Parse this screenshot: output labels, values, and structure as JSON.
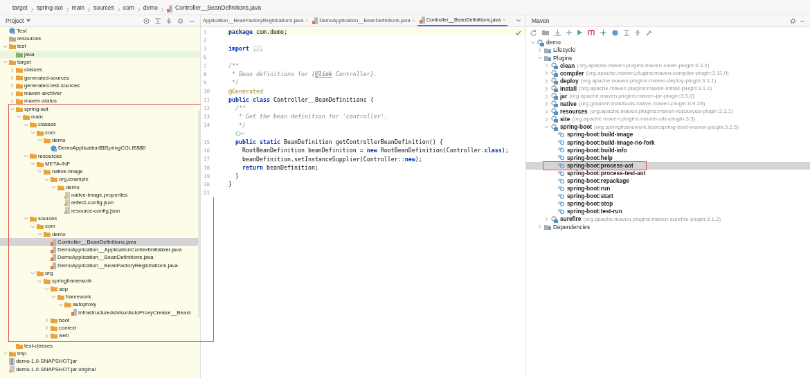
{
  "breadcrumb": [
    "target",
    "spring-aot",
    "main",
    "sources",
    "com",
    "demo",
    "Controller__BeanDefinitions.java"
  ],
  "project": {
    "title": "Project",
    "tree": [
      {
        "label": "Test",
        "kind": "class",
        "selected": false,
        "highlighted": false,
        "boxed": false
      },
      {
        "label": "resources",
        "kind": "resources",
        "selected": false,
        "highlighted": false,
        "boxed": false
      },
      {
        "label": "test",
        "kind": "folder",
        "expanded": true,
        "selected": false,
        "highlighted": false,
        "boxed": false,
        "children": [
          {
            "label": "java",
            "kind": "source",
            "selected": false,
            "highlighted": true,
            "boxed": false
          }
        ]
      },
      {
        "label": "target",
        "kind": "folder",
        "expanded": true,
        "selected": false,
        "highlighted": false,
        "boxed": false,
        "children": [
          {
            "label": "classes",
            "kind": "folder",
            "expanded": false,
            "selected": false,
            "highlighted": false,
            "boxed": false
          },
          {
            "label": "generated-sources",
            "kind": "folder",
            "expanded": false,
            "selected": false,
            "highlighted": false,
            "boxed": false
          },
          {
            "label": "generated-test-sources",
            "kind": "folder",
            "expanded": false,
            "selected": false,
            "highlighted": false,
            "boxed": false
          },
          {
            "label": "maven-archiver",
            "kind": "folder",
            "expanded": false,
            "selected": false,
            "highlighted": false,
            "boxed": false
          },
          {
            "label": "maven-status",
            "kind": "folder",
            "expanded": false,
            "selected": false,
            "highlighted": false,
            "boxed": false
          },
          {
            "label": "spring-aot",
            "kind": "folder",
            "expanded": true,
            "selected": false,
            "highlighted": false,
            "boxed": true,
            "children": [
              {
                "label": "main",
                "kind": "folder",
                "expanded": true,
                "selected": false,
                "highlighted": false,
                "boxed": false,
                "children": [
                  {
                    "label": "classes",
                    "kind": "folder",
                    "expanded": true,
                    "selected": false,
                    "highlighted": false,
                    "boxed": false,
                    "children": [
                      {
                        "label": "com",
                        "kind": "folder",
                        "expanded": true,
                        "selected": false,
                        "highlighted": false,
                        "boxed": false,
                        "children": [
                          {
                            "label": "demo",
                            "kind": "folder",
                            "expanded": true,
                            "selected": false,
                            "highlighted": false,
                            "boxed": false,
                            "children": [
                              {
                                "label": "DemoApplication$$SpringCGLIB$$0",
                                "kind": "class",
                                "selected": false,
                                "highlighted": false,
                                "boxed": false
                              }
                            ]
                          }
                        ]
                      }
                    ]
                  },
                  {
                    "label": "resources",
                    "kind": "folder",
                    "expanded": true,
                    "selected": false,
                    "highlighted": false,
                    "boxed": false,
                    "children": [
                      {
                        "label": "META-INF",
                        "kind": "folder",
                        "expanded": true,
                        "selected": false,
                        "highlighted": false,
                        "boxed": false,
                        "children": [
                          {
                            "label": "native-image",
                            "kind": "folder",
                            "expanded": true,
                            "selected": false,
                            "highlighted": false,
                            "boxed": false,
                            "children": [
                              {
                                "label": "org.example",
                                "kind": "folder",
                                "expanded": true,
                                "selected": false,
                                "highlighted": false,
                                "boxed": false,
                                "children": [
                                  {
                                    "label": "demo",
                                    "kind": "folder",
                                    "expanded": true,
                                    "selected": false,
                                    "highlighted": false,
                                    "boxed": false,
                                    "children": [
                                      {
                                        "label": "native-image.properties",
                                        "kind": "config",
                                        "selected": false,
                                        "highlighted": false,
                                        "boxed": false
                                      },
                                      {
                                        "label": "reflect-config.json",
                                        "kind": "config",
                                        "selected": false,
                                        "highlighted": false,
                                        "boxed": false
                                      },
                                      {
                                        "label": "resource-config.json",
                                        "kind": "config",
                                        "selected": false,
                                        "highlighted": false,
                                        "boxed": false
                                      }
                                    ]
                                  }
                                ]
                              }
                            ]
                          }
                        ]
                      }
                    ]
                  },
                  {
                    "label": "sources",
                    "kind": "folder",
                    "expanded": true,
                    "selected": false,
                    "highlighted": false,
                    "boxed": false,
                    "children": [
                      {
                        "label": "com",
                        "kind": "folder",
                        "expanded": true,
                        "selected": false,
                        "highlighted": false,
                        "boxed": false,
                        "children": [
                          {
                            "label": "demo",
                            "kind": "folder",
                            "expanded": true,
                            "selected": false,
                            "highlighted": false,
                            "boxed": false,
                            "children": [
                              {
                                "label": "Controller__BeanDefinitions.java",
                                "kind": "java",
                                "selected": true,
                                "highlighted": false,
                                "boxed": false
                              },
                              {
                                "label": "DemoApplication__ApplicationContextInitializer.java",
                                "kind": "java",
                                "selected": false,
                                "highlighted": false,
                                "boxed": false
                              },
                              {
                                "label": "DemoApplication__BeanDefinitions.java",
                                "kind": "java",
                                "selected": false,
                                "highlighted": false,
                                "boxed": false
                              },
                              {
                                "label": "DemoApplication__BeanFactoryRegistrations.java",
                                "kind": "java",
                                "selected": false,
                                "highlighted": false,
                                "boxed": false
                              }
                            ]
                          }
                        ]
                      },
                      {
                        "label": "org",
                        "kind": "folder",
                        "expanded": true,
                        "selected": false,
                        "highlighted": false,
                        "boxed": false,
                        "children": [
                          {
                            "label": "springframework",
                            "kind": "folder",
                            "expanded": true,
                            "selected": false,
                            "highlighted": false,
                            "boxed": false,
                            "children": [
                              {
                                "label": "aop",
                                "kind": "folder",
                                "expanded": true,
                                "selected": false,
                                "highlighted": false,
                                "boxed": false,
                                "children": [
                                  {
                                    "label": "framework",
                                    "kind": "folder",
                                    "expanded": true,
                                    "selected": false,
                                    "highlighted": false,
                                    "boxed": false,
                                    "children": [
                                      {
                                        "label": "autoproxy",
                                        "kind": "folder",
                                        "expanded": true,
                                        "selected": false,
                                        "highlighted": false,
                                        "boxed": false,
                                        "children": [
                                          {
                                            "label": "InfrastructureAdvisorAutoProxyCreator__Beanl",
                                            "kind": "java",
                                            "selected": false,
                                            "highlighted": false,
                                            "boxed": false
                                          }
                                        ]
                                      }
                                    ]
                                  }
                                ]
                              },
                              {
                                "label": "boot",
                                "kind": "folder",
                                "expanded": false,
                                "selected": false,
                                "highlighted": false,
                                "boxed": false
                              },
                              {
                                "label": "context",
                                "kind": "folder",
                                "expanded": false,
                                "selected": false,
                                "highlighted": false,
                                "boxed": false
                              },
                              {
                                "label": "web",
                                "kind": "folder",
                                "expanded": false,
                                "selected": false,
                                "highlighted": false,
                                "boxed": false
                              }
                            ]
                          }
                        ]
                      }
                    ]
                  }
                ]
              }
            ]
          },
          {
            "label": "test-classes",
            "kind": "folder",
            "selected": false,
            "highlighted": false,
            "boxed": false
          }
        ]
      },
      {
        "label": "tmp",
        "kind": "folder",
        "expanded": false,
        "selected": false,
        "highlighted": false,
        "boxed": false
      },
      {
        "label": "demo-1.0-SNAPSHOT.jar",
        "kind": "jar",
        "selected": false,
        "highlighted": false,
        "boxed": false
      },
      {
        "label": "demo-1.0-SNAPSHOT.jar.original",
        "kind": "config",
        "selected": false,
        "highlighted": false,
        "boxed": false
      }
    ]
  },
  "editor": {
    "tabs": [
      {
        "label": "Application__BeanFactoryRegistrations.java",
        "close": "×",
        "selected": false
      },
      {
        "label": "DemoApplication__BeanDefinitions.java",
        "close": "×",
        "selected": false
      },
      {
        "label": "Controller__BeanDefinitions.java",
        "close": "×",
        "selected": true
      }
    ],
    "lines": [
      {
        "kind": "code",
        "number": "1",
        "current": true,
        "segments": [
          {
            "text": "package",
            "kind": "keyword"
          },
          {
            "text": " com.demo;",
            "kind": "plain"
          }
        ]
      },
      {
        "kind": "code",
        "number": "2",
        "current": false
      },
      {
        "kind": "code",
        "number": "3",
        "current": false,
        "segments": [
          {
            "text": "import ",
            "kind": "keyword"
          },
          {
            "text": "...",
            "kind": "fold"
          }
        ]
      },
      {
        "kind": "code",
        "number": "6",
        "current": false
      },
      {
        "kind": "code",
        "number": "7",
        "current": false,
        "segments": [
          {
            "text": "/**",
            "kind": "comment"
          }
        ]
      },
      {
        "kind": "code",
        "number": "8",
        "current": false,
        "segments": [
          {
            "text": " * Bean definitions for {",
            "kind": "comment"
          },
          {
            "text": "@link",
            "kind": "tag"
          },
          {
            "text": " Controller}.",
            "kind": "comment"
          }
        ]
      },
      {
        "kind": "code",
        "number": "9",
        "current": false,
        "segments": [
          {
            "text": " */",
            "kind": "comment"
          }
        ]
      },
      {
        "kind": "code",
        "number": "10",
        "current": false,
        "segments": [
          {
            "text": "@Generated",
            "kind": "annotation"
          }
        ]
      },
      {
        "kind": "code",
        "number": "11",
        "current": false,
        "segments": [
          {
            "text": "public class",
            "kind": "keyword"
          },
          {
            "text": " Controller__BeanDefinitions {",
            "kind": "plain"
          }
        ]
      },
      {
        "kind": "code",
        "number": "12",
        "current": false,
        "segments": [
          {
            "text": "  /**",
            "kind": "comment"
          }
        ]
      },
      {
        "kind": "code",
        "number": "13",
        "current": false,
        "segments": [
          {
            "text": "   * Get the bean definition for 'controller'.",
            "kind": "comment"
          }
        ]
      },
      {
        "kind": "code",
        "number": "14",
        "current": false,
        "segments": [
          {
            "text": "   */",
            "kind": "comment"
          }
        ]
      },
      {
        "kind": "marker",
        "current": false
      },
      {
        "kind": "code",
        "number": "15",
        "current": false,
        "segments": [
          {
            "text": "  public static",
            "kind": "keyword"
          },
          {
            "text": " BeanDefinition getControllerBeanDefinition() {",
            "kind": "plain"
          }
        ]
      },
      {
        "kind": "code",
        "number": "16",
        "current": false,
        "segments": [
          {
            "text": "    RootBeanDefinition beanDefinition = ",
            "kind": "plain"
          },
          {
            "text": "new",
            "kind": "keyword"
          },
          {
            "text": " RootBeanDefinition(Controller.",
            "kind": "plain"
          },
          {
            "text": "class",
            "kind": "keyword"
          },
          {
            "text": ");",
            "kind": "plain"
          }
        ]
      },
      {
        "kind": "code",
        "number": "17",
        "current": false,
        "segments": [
          {
            "text": "    beanDefinition.setInstanceSupplier(Controller::",
            "kind": "plain"
          },
          {
            "text": "new",
            "kind": "keyword"
          },
          {
            "text": ");",
            "kind": "plain"
          }
        ]
      },
      {
        "kind": "code",
        "number": "18",
        "current": false,
        "segments": [
          {
            "text": "    return",
            "kind": "keyword"
          },
          {
            "text": " beanDefinition;",
            "kind": "plain"
          }
        ]
      },
      {
        "kind": "code",
        "number": "19",
        "current": false,
        "segments": [
          {
            "text": "  }",
            "kind": "plain"
          }
        ]
      },
      {
        "kind": "code",
        "number": "20",
        "current": false,
        "segments": [
          {
            "text": "}",
            "kind": "plain"
          }
        ]
      },
      {
        "kind": "code",
        "number": "21",
        "current": false
      }
    ]
  },
  "maven": {
    "title": "Maven",
    "tree": [
      {
        "label": "demo",
        "kind": "project",
        "expanded": true,
        "selected": false,
        "boxed": false,
        "children": [
          {
            "label": "Lifecycle",
            "kind": "group",
            "expanded": false,
            "selected": false,
            "boxed": false
          },
          {
            "label": "Plugins",
            "kind": "group",
            "expanded": true,
            "selected": false,
            "boxed": false,
            "children": [
              {
                "label": "clean",
                "detail": "(org.apache.maven.plugins:maven-clean-plugin:3.3.2)",
                "kind": "plugin",
                "expanded": false,
                "selected": false,
                "boxed": false
              },
              {
                "label": "compiler",
                "detail": "(org.apache.maven.plugins:maven-compiler-plugin:3.11.0)",
                "kind": "plugin",
                "expanded": false,
                "selected": false,
                "boxed": false
              },
              {
                "label": "deploy",
                "detail": "(org.apache.maven.plugins:maven-deploy-plugin:3.1.1)",
                "kind": "plugin",
                "expanded": false,
                "selected": false,
                "boxed": false
              },
              {
                "label": "install",
                "detail": "(org.apache.maven.plugins:maven-install-plugin:3.1.1)",
                "kind": "plugin",
                "expanded": false,
                "selected": false,
                "boxed": false
              },
              {
                "label": "jar",
                "detail": "(org.apache.maven.plugins:maven-jar-plugin:3.3.0)",
                "kind": "plugin",
                "expanded": false,
                "selected": false,
                "boxed": false
              },
              {
                "label": "native",
                "detail": "(org.graalvm.buildtools:native-maven-plugin:0.9.28)",
                "kind": "plugin",
                "expanded": false,
                "selected": false,
                "boxed": false
              },
              {
                "label": "resources",
                "detail": "(org.apache.maven.plugins:maven-resources-plugin:3.3.1)",
                "kind": "plugin",
                "expanded": false,
                "selected": false,
                "boxed": false
              },
              {
                "label": "site",
                "detail": "(org.apache.maven.plugins:maven-site-plugin:3.3)",
                "kind": "plugin",
                "expanded": false,
                "selected": false,
                "boxed": false
              },
              {
                "label": "spring-boot",
                "detail": "(org.springframework.boot:spring-boot-maven-plugin:3.2.5)",
                "kind": "plugin",
                "expanded": true,
                "selected": false,
                "boxed": false,
                "children": [
                  {
                    "label": "spring-boot:build-image",
                    "kind": "goal",
                    "selected": false,
                    "boxed": false
                  },
                  {
                    "label": "spring-boot:build-image-no-fork",
                    "kind": "goal",
                    "selected": false,
                    "boxed": false
                  },
                  {
                    "label": "spring-boot:build-info",
                    "kind": "goal",
                    "selected": false,
                    "boxed": false
                  },
                  {
                    "label": "spring-boot:help",
                    "kind": "goal",
                    "selected": false,
                    "boxed": false
                  },
                  {
                    "label": "spring-boot:process-aot",
                    "kind": "goal",
                    "selected": true,
                    "boxed": true
                  },
                  {
                    "label": "spring-boot:process-test-aot",
                    "kind": "goal",
                    "selected": false,
                    "boxed": false
                  },
                  {
                    "label": "spring-boot:repackage",
                    "kind": "goal",
                    "selected": false,
                    "boxed": false
                  },
                  {
                    "label": "spring-boot:run",
                    "kind": "goal",
                    "selected": false,
                    "boxed": false
                  },
                  {
                    "label": "spring-boot:start",
                    "kind": "goal",
                    "selected": false,
                    "boxed": false
                  },
                  {
                    "label": "spring-boot:stop",
                    "kind": "goal",
                    "selected": false,
                    "boxed": false
                  },
                  {
                    "label": "spring-boot:test-run",
                    "kind": "goal",
                    "selected": false,
                    "boxed": false
                  }
                ]
              },
              {
                "label": "surefire",
                "detail": "(org.apache.maven.plugins:maven-surefire-plugin:3.1.2)",
                "kind": "plugin",
                "expanded": false,
                "selected": false,
                "boxed": false
              }
            ]
          },
          {
            "label": "Dependencies",
            "kind": "group",
            "expanded": false,
            "selected": false,
            "boxed": false
          }
        ]
      }
    ]
  }
}
